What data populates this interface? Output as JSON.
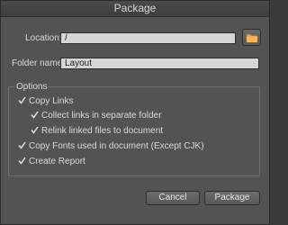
{
  "dialog": {
    "title": "Package"
  },
  "location": {
    "label": "Location:",
    "value": "/"
  },
  "folder_name": {
    "label": "Folder name:",
    "value": "Layout"
  },
  "options": {
    "label": "Options",
    "copy_links": "Copy Links",
    "collect_links": "Collect links in separate folder",
    "relink": "Relink linked files to document",
    "copy_fonts": "Copy Fonts used in document (Except CJK)",
    "create_report": "Create Report",
    "checked": [
      true,
      true,
      true,
      true,
      true
    ]
  },
  "buttons": {
    "cancel": "Cancel",
    "package": "Package"
  },
  "icons": {
    "browse": "folder-icon",
    "check": "checkmark-icon"
  },
  "colors": {
    "dialog_bg": "#535353",
    "field_bg": "#d6d6d6",
    "folder_icon": "#f0a040"
  }
}
